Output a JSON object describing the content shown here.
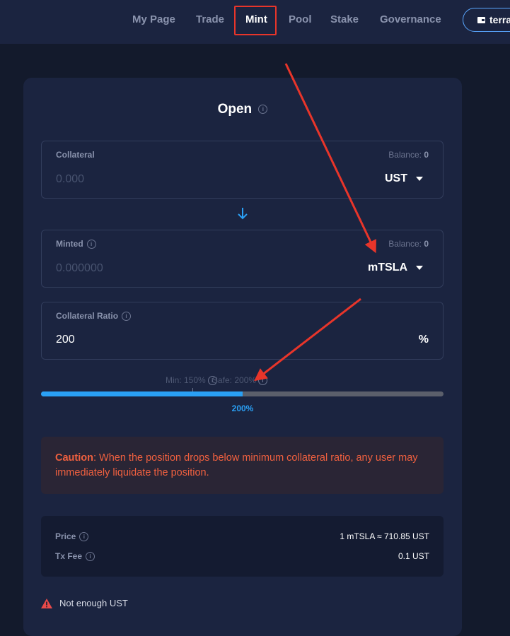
{
  "nav": {
    "items": [
      {
        "label": "My Page"
      },
      {
        "label": "Trade"
      },
      {
        "label": "Mint"
      },
      {
        "label": "Pool"
      },
      {
        "label": "Stake"
      },
      {
        "label": "Governance"
      }
    ],
    "wallet_label": "terra"
  },
  "form": {
    "title": "Open",
    "collateral": {
      "label": "Collateral",
      "balance_label": "Balance:",
      "balance_value": "0",
      "placeholder": "0.000",
      "token": "UST"
    },
    "minted": {
      "label": "Minted",
      "balance_label": "Balance:",
      "balance_value": "0",
      "placeholder": "0.000000",
      "token": "mTSLA"
    },
    "ratio": {
      "label": "Collateral Ratio",
      "value": "200",
      "unit": "%"
    },
    "slider": {
      "min_label": "Min: 150%",
      "safe_label": "Safe: 200%",
      "value_label": "200%",
      "fill_fraction": 0.5
    },
    "caution": {
      "title": "Caution",
      "text": ": When the position drops below minimum collateral ratio, any user may immediately liquidate the position."
    },
    "summary": {
      "price_label": "Price",
      "price_value": "1 mTSLA ≈ 710.85 UST",
      "fee_label": "Tx Fee",
      "fee_value": "0.1 UST"
    },
    "warning": "Not enough UST"
  },
  "colors": {
    "accent": "#2aa0f5",
    "caution": "#f0603f",
    "highlight": "#e8352a",
    "background": "#131a2c",
    "card": "#1b2440"
  },
  "icons": {
    "info": "info-icon",
    "caret": "chevron-down-icon",
    "down_arrow": "arrow-down-icon",
    "warning": "warning-triangle-icon",
    "wallet": "wallet-icon"
  }
}
